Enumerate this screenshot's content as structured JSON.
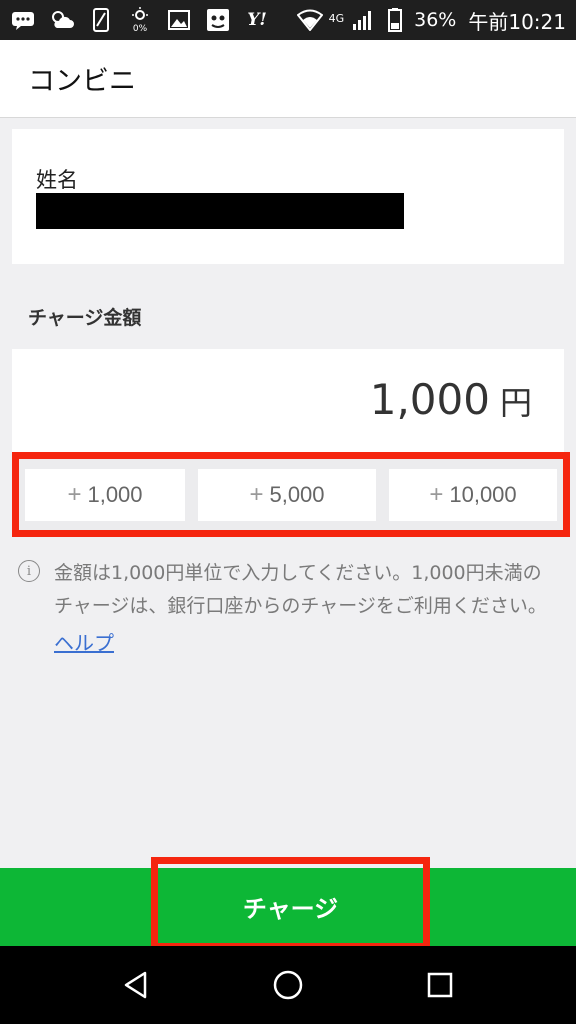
{
  "status_bar": {
    "yahoo": "Y!",
    "network": "4G",
    "battery": "36%",
    "time": "午前10:21",
    "icons": [
      "message-icon",
      "weather-icon",
      "phone-icon",
      "brightness-icon",
      "image-icon",
      "face-icon",
      "yahoo-icon",
      "wifi-icon",
      "signal-icon",
      "battery-icon"
    ]
  },
  "header": {
    "title": "コンビニ"
  },
  "name_section": {
    "label": "姓名"
  },
  "charge": {
    "section_label": "チャージ金額",
    "amount": "1,000",
    "unit": "円",
    "quick_buttons": [
      {
        "plus": "+",
        "label": "1,000"
      },
      {
        "plus": "+",
        "label": "5,000"
      },
      {
        "plus": "+",
        "label": "10,000"
      }
    ]
  },
  "info": {
    "icon_glyph": "i",
    "text": "金額は1,000円単位で入力してください。1,000円未満のチャージは、銀行口座からのチャージをご利用ください。",
    "help_link": "ヘルプ"
  },
  "footer": {
    "charge_button": "チャージ"
  },
  "nav": {
    "icons": [
      "back-icon",
      "home-icon",
      "recents-icon"
    ]
  },
  "colors": {
    "accent_green": "#0db736",
    "highlight_red": "#f5260f",
    "link_blue": "#3a6fd1"
  }
}
